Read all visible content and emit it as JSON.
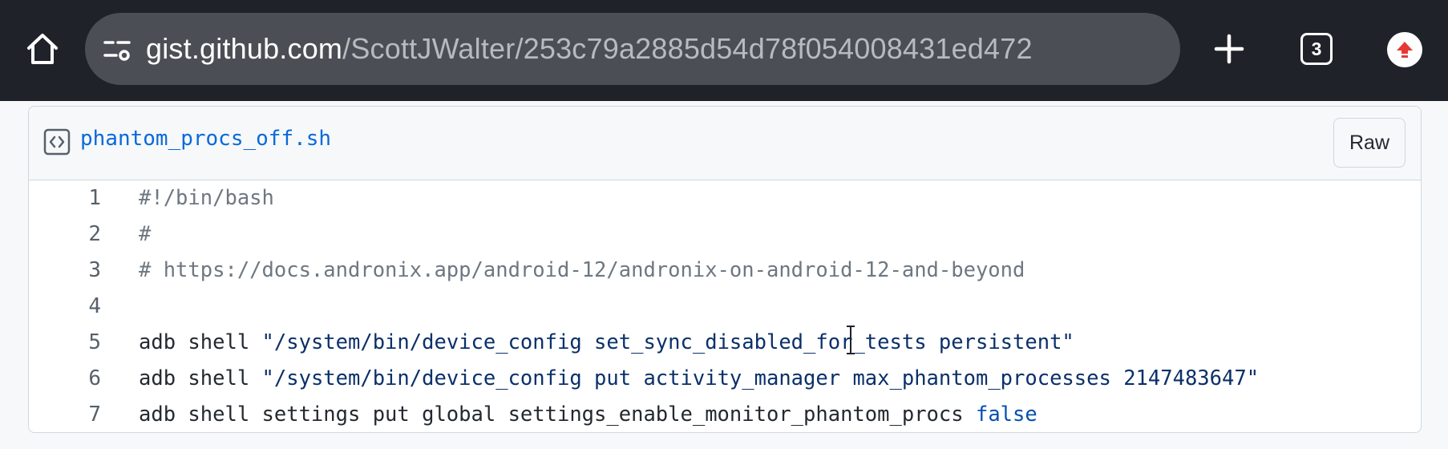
{
  "browser": {
    "url_domain": "gist.github.com",
    "url_path": "/ScottJWalter/253c79a2885d54d78f054008431ed472",
    "tab_count": "3",
    "icons": {
      "home": "home-icon",
      "site_settings": "tune-icon",
      "new_tab": "plus-icon",
      "update": "update-arrow-icon"
    },
    "colors": {
      "toolbar": "#1f2329",
      "urlbar": "#4b4f55",
      "update_accent": "#e53935"
    }
  },
  "gist_file": {
    "file_name": "phantom_procs_off.sh",
    "raw_label": "Raw",
    "icon": "code-file-icon",
    "lines": [
      {
        "num": "1",
        "segments": [
          {
            "text": "#!/bin/bash",
            "style": "comment"
          }
        ]
      },
      {
        "num": "2",
        "segments": [
          {
            "text": "#",
            "style": "comment"
          }
        ]
      },
      {
        "num": "3",
        "segments": [
          {
            "text": "# https://docs.andronix.app/android-12/andronix-on-android-12-and-beyond",
            "style": "comment"
          }
        ]
      },
      {
        "num": "4",
        "segments": []
      },
      {
        "num": "5",
        "segments": [
          {
            "text": "adb shell ",
            "style": "plain"
          },
          {
            "text": "\"/system/bin/device_config set_sync_disabled_for_tests persistent\"",
            "style": "string"
          }
        ]
      },
      {
        "num": "6",
        "segments": [
          {
            "text": "adb shell ",
            "style": "plain"
          },
          {
            "text": "\"/system/bin/device_config put activity_manager max_phantom_processes 2147483647\"",
            "style": "string"
          }
        ]
      },
      {
        "num": "7",
        "segments": [
          {
            "text": "adb shell settings put global settings_enable_monitor_phantom_procs ",
            "style": "plain"
          },
          {
            "text": "false",
            "style": "keyword"
          }
        ]
      }
    ]
  }
}
